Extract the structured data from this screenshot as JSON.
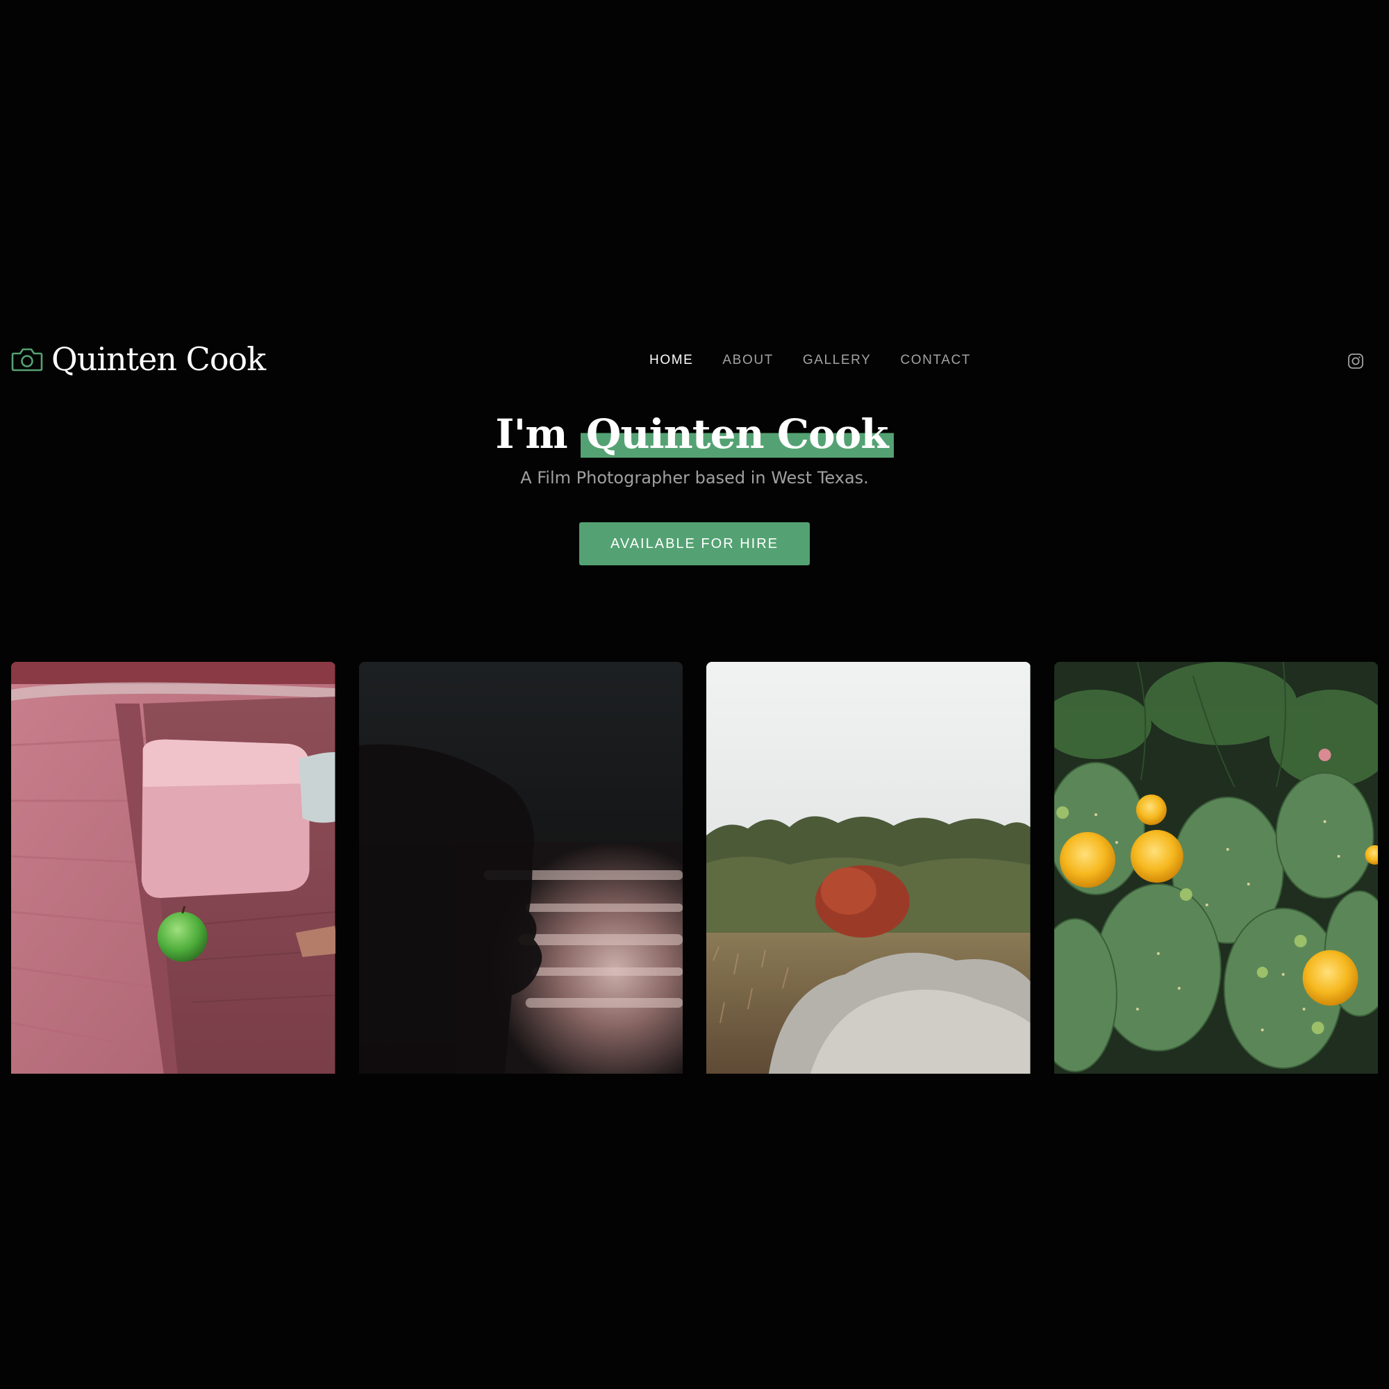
{
  "header": {
    "brand_name": "Quinten Cook",
    "brand_icon": "camera-icon",
    "nav": [
      {
        "label": "HOME",
        "active": true
      },
      {
        "label": "ABOUT",
        "active": false
      },
      {
        "label": "GALLERY",
        "active": false
      },
      {
        "label": "CONTACT",
        "active": false
      }
    ],
    "social_icon": "instagram-icon"
  },
  "hero": {
    "title_prefix": "I'm",
    "title_highlight": "Quinten Cook",
    "subtitle": "A Film Photographer based in West Texas.",
    "cta_label": "AVAILABLE FOR HIRE"
  },
  "gallery": {
    "photos": [
      {
        "subject": "pink-car-seat-with-green-apple"
      },
      {
        "subject": "blurred-portrait-silhouette"
      },
      {
        "subject": "west-texas-brush-landscape"
      },
      {
        "subject": "prickly-pear-cactus-yellow-flowers"
      }
    ]
  },
  "colors": {
    "background": "#030303",
    "accent": "#54a273",
    "nav_inactive": "#a3a3a3",
    "subtitle": "#a0a0a0",
    "text": "#ffffff"
  }
}
